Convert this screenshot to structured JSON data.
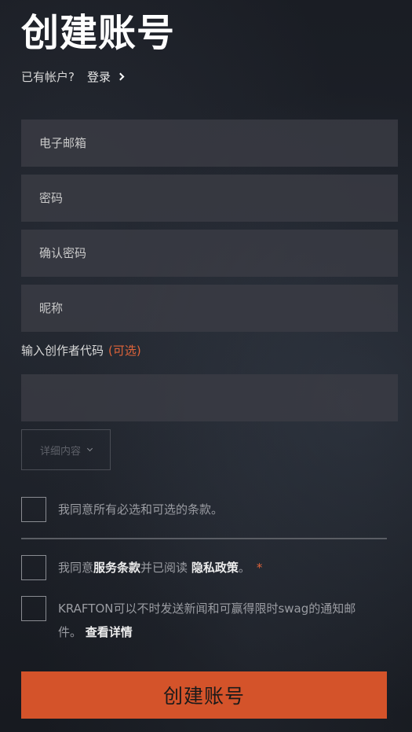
{
  "header": {
    "title": "创建账号",
    "have_account_text": "已有帐户?",
    "login_link": "登录"
  },
  "form": {
    "email_placeholder": "电子邮箱",
    "password_placeholder": "密码",
    "confirm_password_placeholder": "确认密码",
    "nickname_placeholder": "昵称",
    "creator_code_label": "输入创作者代码",
    "creator_code_optional": "(可选)",
    "creator_code_value": "",
    "details_label": "详细内容"
  },
  "terms": {
    "agree_all": "我同意所有必选和可选的条款。",
    "agree_prefix": "我同意",
    "terms_of_service": "服务条款",
    "and_read": "并已阅读",
    "privacy_policy": "隐私政策",
    "period": "。",
    "required_mark": "*",
    "newsletter_text": "KRAFTON可以不时发送新闻和可赢得限时swag的通知邮件。",
    "view_details": "查看详情"
  },
  "submit_label": "创建账号",
  "colors": {
    "accent": "#d4532a",
    "optional_text": "#e0643a"
  }
}
